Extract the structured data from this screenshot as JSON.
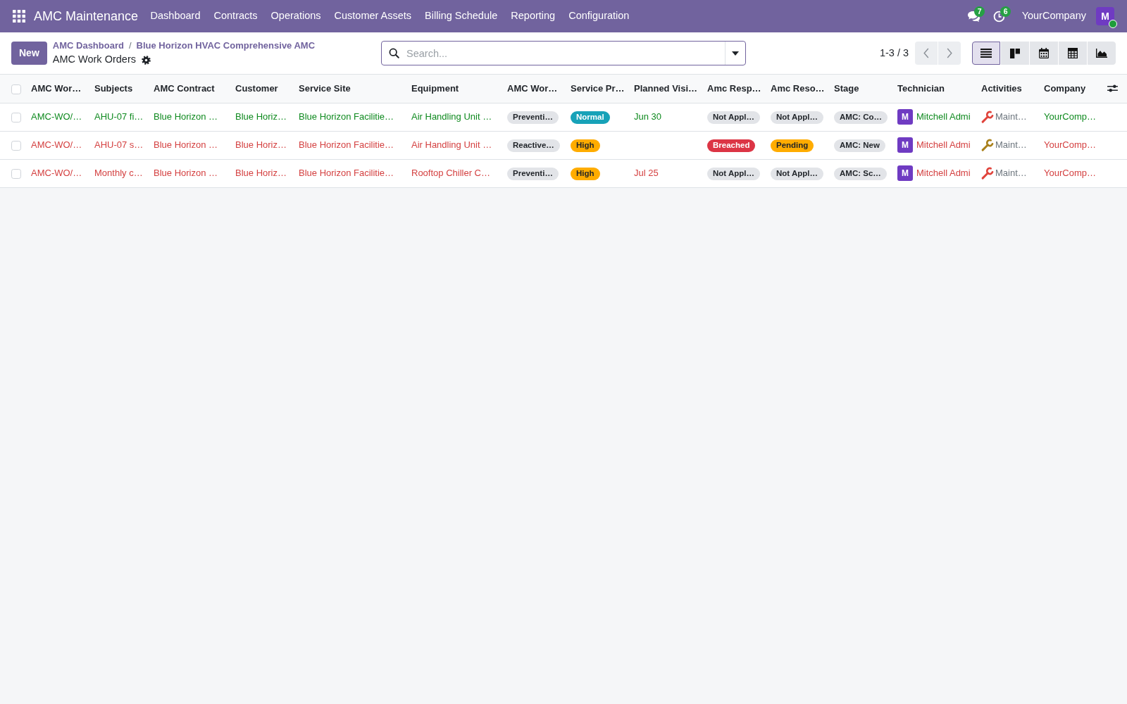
{
  "navbar": {
    "app_name": "AMC Maintenance",
    "menu": [
      "Dashboard",
      "Contracts",
      "Operations",
      "Customer Assets",
      "Billing Schedule",
      "Reporting",
      "Configuration"
    ],
    "messages_count": "7",
    "activities_count": "6",
    "company": "YourCompany",
    "user_initial": "M",
    "user_online": true
  },
  "control_panel": {
    "new_button": "New",
    "breadcrumbs": [
      "AMC Dashboard",
      "Blue Horizon HVAC Comprehensive AMC"
    ],
    "breadcrumb_separator": "/",
    "title": "AMC Work Orders",
    "search": {
      "placeholder": "Search..."
    },
    "pager": "1-3 / 3",
    "views": [
      {
        "kind": "list",
        "selected": true
      },
      {
        "kind": "kanban",
        "selected": false
      },
      {
        "kind": "calendar",
        "selected": false
      },
      {
        "kind": "pivot",
        "selected": false
      },
      {
        "kind": "graph",
        "selected": false
      }
    ]
  },
  "table": {
    "select_all": {
      "checked": false
    },
    "columns": [
      "AMC Wor…",
      "Subjects",
      "AMC Contract",
      "Customer",
      "Service Site",
      "Equipment",
      "AMC Wor…",
      "Service Pr…",
      "Planned Visi…",
      "Amc Resp…",
      "Amc Reso…",
      "Stage",
      "Technician",
      "Activities",
      "Company"
    ],
    "rows": [
      {
        "color": "#0f8a1f",
        "checked": false,
        "cells": [
          {
            "kind": "text",
            "text": "AMC-WO/…"
          },
          {
            "kind": "text",
            "text": "AHU-07 fi…"
          },
          {
            "kind": "text",
            "text": "Blue Horizon …"
          },
          {
            "kind": "text",
            "text": "Blue Horiz…"
          },
          {
            "kind": "text",
            "text": "Blue Horizon Facilitie…"
          },
          {
            "kind": "text",
            "text": "Air Handling Unit …"
          },
          {
            "kind": "badge",
            "text": "Preventi…",
            "color": "#e2e4e8"
          },
          {
            "kind": "badge",
            "text": "Normal",
            "color": "#17a2b8"
          },
          {
            "kind": "text",
            "text": "Jun 30"
          },
          {
            "kind": "badge",
            "text": "Not Appl…",
            "color": "#e2e4e8"
          },
          {
            "kind": "badge",
            "text": "Not Appl…",
            "color": "#e2e4e8"
          },
          {
            "kind": "badge",
            "text": "AMC: Co…",
            "color": "#e2e4e8"
          },
          {
            "kind": "avatar",
            "initial": "M",
            "text": "Mitchell Admi"
          },
          {
            "kind": "activity",
            "color": "#e0443c",
            "text": "Maint…"
          },
          {
            "kind": "text",
            "text": "YourComp…"
          }
        ]
      },
      {
        "color": "#d44040",
        "checked": false,
        "cells": [
          {
            "kind": "text",
            "text": "AMC-WO/…"
          },
          {
            "kind": "text",
            "text": "AHU-07 s…"
          },
          {
            "kind": "text",
            "text": "Blue Horizon …"
          },
          {
            "kind": "text",
            "text": "Blue Horiz…"
          },
          {
            "kind": "text",
            "text": "Blue Horizon Facilitie…"
          },
          {
            "kind": "text",
            "text": "Air Handling Unit …"
          },
          {
            "kind": "badge",
            "text": "Reactive…",
            "color": "#e2e4e8"
          },
          {
            "kind": "badge",
            "text": "High",
            "color": "#ffac00"
          },
          {
            "kind": "blank"
          },
          {
            "kind": "badge",
            "text": "Breached",
            "color": "#dc3545"
          },
          {
            "kind": "badge",
            "text": "Pending",
            "color": "#ffac00"
          },
          {
            "kind": "badge",
            "text": "AMC: New",
            "color": "#e2e4e8"
          },
          {
            "kind": "avatar",
            "initial": "M",
            "text": "Mitchell Admi"
          },
          {
            "kind": "activity",
            "color": "#a9801b",
            "text": "Maint…"
          },
          {
            "kind": "text",
            "text": "YourComp…"
          }
        ]
      },
      {
        "color": "#d44040",
        "checked": false,
        "cells": [
          {
            "kind": "text",
            "text": "AMC-WO/…"
          },
          {
            "kind": "text",
            "text": "Monthly c…"
          },
          {
            "kind": "text",
            "text": "Blue Horizon …"
          },
          {
            "kind": "text",
            "text": "Blue Horiz…"
          },
          {
            "kind": "text",
            "text": "Blue Horizon Facilitie…"
          },
          {
            "kind": "text",
            "text": "Rooftop Chiller C…"
          },
          {
            "kind": "badge",
            "text": "Preventi…",
            "color": "#e2e4e8"
          },
          {
            "kind": "badge",
            "text": "High",
            "color": "#ffac00"
          },
          {
            "kind": "text",
            "text": "Jul 25"
          },
          {
            "kind": "badge",
            "text": "Not Appl…",
            "color": "#e2e4e8"
          },
          {
            "kind": "badge",
            "text": "Not Appl…",
            "color": "#e2e4e8"
          },
          {
            "kind": "badge",
            "text": "AMC: Sc…",
            "color": "#e2e4e8"
          },
          {
            "kind": "avatar",
            "initial": "M",
            "text": "Mitchell Admi"
          },
          {
            "kind": "activity",
            "color": "#e0443c",
            "text": "Maint…"
          },
          {
            "kind": "text",
            "text": "YourComp…"
          }
        ]
      }
    ]
  }
}
